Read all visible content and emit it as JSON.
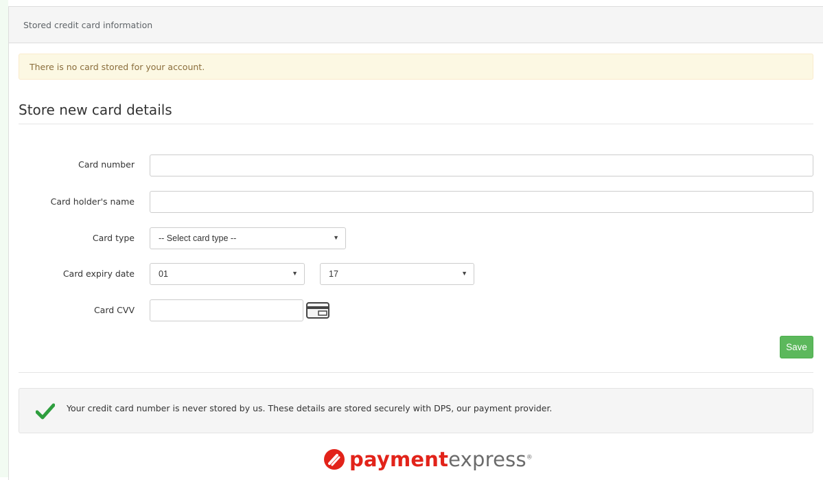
{
  "panel": {
    "heading": "Stored credit card information"
  },
  "alert": {
    "text": "There is no card stored for your account."
  },
  "section": {
    "title": "Store new card details"
  },
  "form": {
    "card_number_label": "Card number",
    "card_number_value": "",
    "card_holder_label": "Card holder's name",
    "card_holder_value": "",
    "card_type_label": "Card type",
    "card_type_selected": "-- Select card type --",
    "expiry_label": "Card expiry date",
    "expiry_month_selected": "01",
    "expiry_year_selected": "17",
    "cvv_label": "Card CVV",
    "cvv_value": "",
    "cvv_icon": "credit-card-icon",
    "save_label": "Save"
  },
  "info": {
    "icon": "checkmark-icon",
    "text": "Your credit card number is never stored by us. These details are stored securely with DPS, our payment provider."
  },
  "logo": {
    "word_payment": "payment",
    "word_express": "express",
    "registered": "®"
  },
  "colors": {
    "alert_bg": "#fcf8e3",
    "alert_text": "#8a6d3b",
    "save_button": "#5cb85c",
    "check_green": "#2e9e3e",
    "logo_red": "#e2231a",
    "logo_gray": "#6b6b6b"
  }
}
